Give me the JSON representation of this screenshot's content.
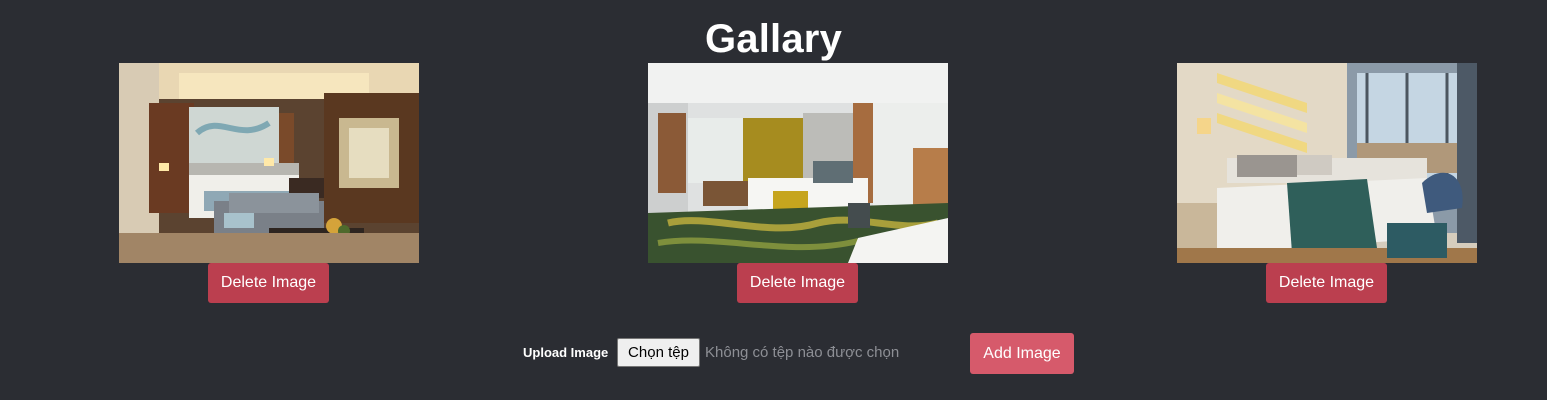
{
  "page": {
    "title": "Gallary"
  },
  "gallery": {
    "images": [
      {
        "alt": "Hotel room with bed, sofa and glass bathroom",
        "delete_label": "Delete Image"
      },
      {
        "alt": "Hotel room with green-yellow carpet and mustard curtains",
        "delete_label": "Delete Image"
      },
      {
        "alt": "Hotel room with teal bed runner and large windows",
        "delete_label": "Delete Image"
      }
    ]
  },
  "upload": {
    "label": "Upload Image",
    "choose_file_label": "Chọn tệp",
    "no_file_text": "Không có tệp nào được chọn",
    "add_button_label": "Add Image"
  },
  "colors": {
    "background": "#2b2d33",
    "delete_button": "#bb3f4f",
    "add_button": "#d65a6b"
  }
}
